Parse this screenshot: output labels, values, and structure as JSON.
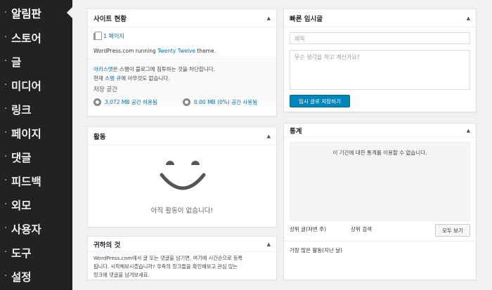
{
  "sidebar": {
    "items": [
      {
        "label": "알림판"
      },
      {
        "label": "스토어"
      },
      {
        "label": "글"
      },
      {
        "label": "미디어"
      },
      {
        "label": "링크"
      },
      {
        "label": "페이지"
      },
      {
        "label": "댓글"
      },
      {
        "label": "피드백"
      },
      {
        "label": "외모"
      },
      {
        "label": "사용자"
      },
      {
        "label": "도구"
      },
      {
        "label": "설정"
      }
    ],
    "bullet": "·"
  },
  "toggle_glyph": "▲",
  "glance": {
    "title": "사이트 현황",
    "pages": "1 페이지",
    "running_prefix": "WordPress.com running ",
    "theme": "Twenty Twelve",
    "running_suffix": " theme.",
    "akismet_link": "아키스멧",
    "akismet_text": "은 스팸이 블로그에 침투하는 것을 차단합니다.",
    "spam_prefix": "현재 ",
    "spam_link": "스팸 큐",
    "spam_suffix": "에 아무것도 없습니다.",
    "storage_heading": "저장 공간",
    "storage_allowed": "3,072 MB 공간 허용됨",
    "storage_used": "0.00 MB (0%) 공간 사용됨"
  },
  "activity": {
    "title": "활동",
    "empty": "아직 활동이 없습니다!"
  },
  "yours": {
    "title": "귀하의 것",
    "line1": "WordPress.com에서 글 또는 댓글을 남기면, 여기에 시간순으로 등록",
    "line2": "됩니다. 시작해보시겠습니까? 우측의 링크들을 확인해보고 관심 있는",
    "line3": "링크에 댓글을 남겨보세요."
  },
  "quick_draft": {
    "title": "빠른 임시글",
    "title_placeholder": "제목",
    "content_placeholder": "무슨 생각을 하고 계신가요?",
    "save_label": "임시 글로 저장하기"
  },
  "stats": {
    "title": "통계",
    "empty": "이 기간에 대한 통계를 이용할 수 없습니다.",
    "top_posts": "상위 글(저번 주)",
    "top_searches": "상위 검색",
    "view_all": "모두 보기",
    "most_active": "가장 많은 활동(지난 날)"
  },
  "colors": {
    "sidebar_bg": "#222222",
    "link": "#0073aa",
    "button": "#0085ba"
  }
}
